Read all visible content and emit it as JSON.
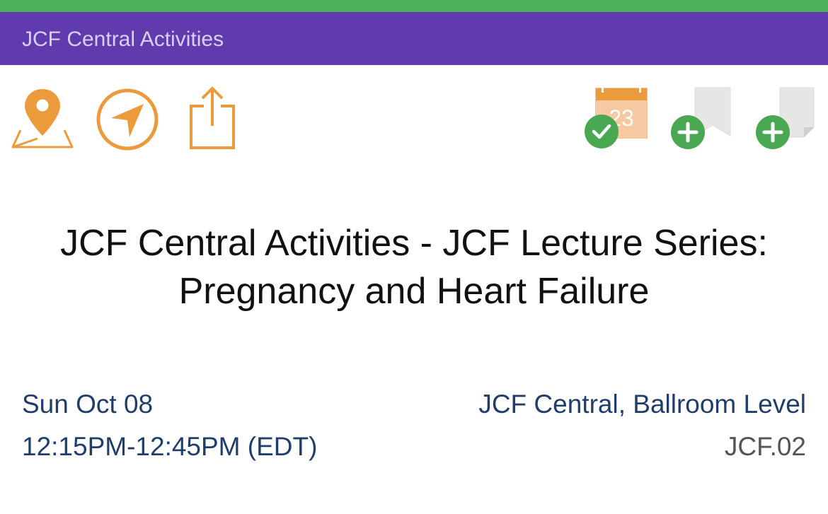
{
  "colors": {
    "top_stripe": "#4caf5c",
    "header_bg": "#603bae",
    "header_text": "#d9cff2",
    "icon_orange": "#eb9a3c",
    "badge_green": "#4ba852",
    "meta_blue": "#1f3e6b",
    "meta_gray": "#555555"
  },
  "header": {
    "title": "JCF Central Activities"
  },
  "toolbar": {
    "left_icons": [
      "map-pin-icon",
      "navigation-arrow-icon",
      "share-icon"
    ],
    "right_icons": [
      "calendar-added-icon",
      "add-bookmark-icon",
      "add-note-icon"
    ],
    "calendar_day": "23"
  },
  "event": {
    "title": "JCF Central Activities - JCF Lecture Series: Pregnancy and Heart Failure",
    "date": "Sun Oct 08",
    "time": "12:15PM-12:45PM (EDT)",
    "location": "JCF Central, Ballroom Level",
    "code": "JCF.02"
  }
}
